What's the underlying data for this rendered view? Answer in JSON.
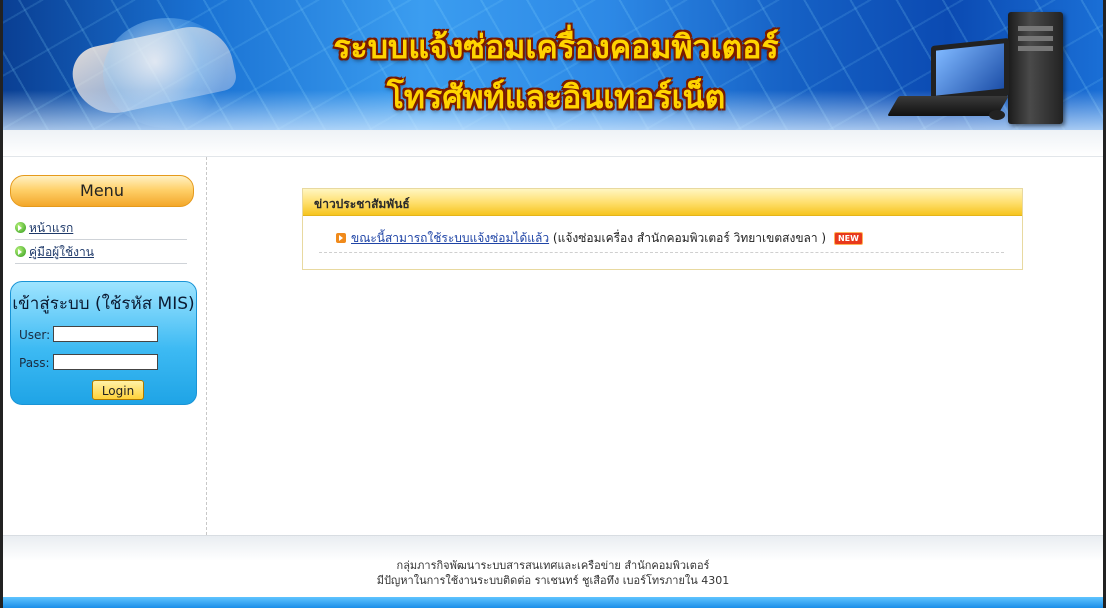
{
  "banner": {
    "title_line1": "ระบบแจ้งซ่อมเครื่องคอมพิวเตอร์",
    "title_line2": "โทรศัพท์และอินเทอร์เน็ต"
  },
  "sidebar": {
    "menu_title": "Menu",
    "items": [
      {
        "label": "หน้าแรก"
      },
      {
        "label": "คู่มือผู้ใช้งาน"
      }
    ]
  },
  "login": {
    "title": "เข้าสู่ระบบ (ใช้รหัส MIS)",
    "user_label": "User:",
    "pass_label": "Pass:",
    "user_value": "",
    "pass_value": "",
    "button_label": "Login"
  },
  "news": {
    "title": "ข่าวประชาสัมพันธ์",
    "items": [
      {
        "link_text": "ขณะนี้สามารถใช้ระบบแจ้งซ่อมได้แล้ว",
        "detail": "(แจ้งซ่อมเครื่อง สำนักคอมพิวเตอร์ วิทยาเขตสงขลา )",
        "badge": "NEW"
      }
    ]
  },
  "footer": {
    "line1": "กลุ่มภารกิจพัฒนาระบบสารสนเทศและเครือข่าย สำนักคอมพิวเตอร์",
    "line2": "มีปัญหาในการใช้งานระบบติดต่อ ราเชนทร์ ชูเสือทึง เบอร์โทรภายใน 4301"
  },
  "colors": {
    "banner_title": "#ffd400",
    "menu_header": "#ffd16b",
    "login_box": "#3dbaf3",
    "news_header": "#ffe071",
    "link": "#1f44a6"
  },
  "icons": {
    "nav_bullet": "green-arrow-circle-icon",
    "news_bullet": "orange-arrow-square-icon"
  }
}
